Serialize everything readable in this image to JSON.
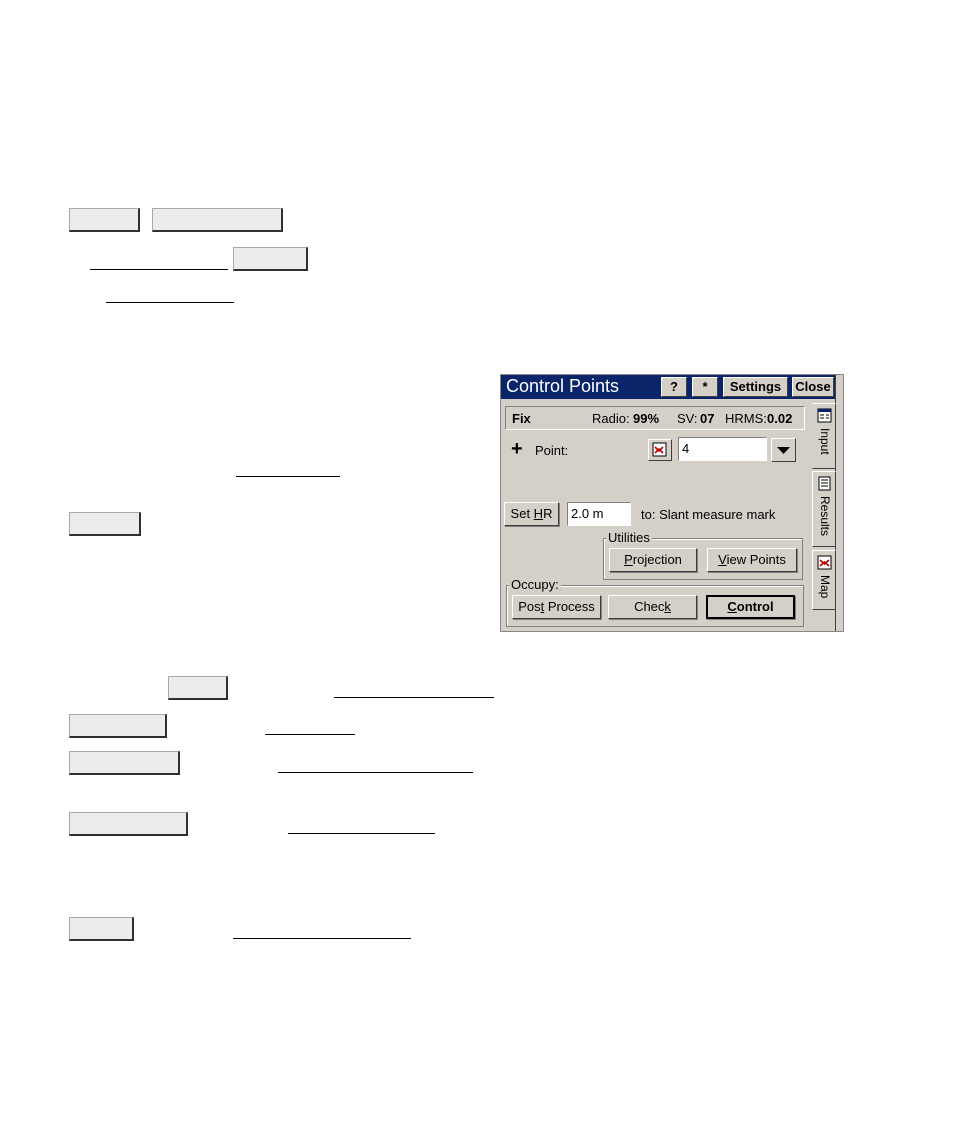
{
  "window": {
    "title": "Control Points",
    "help_label": "?",
    "star_label": "*",
    "settings_label": "Settings",
    "close_label": "Close"
  },
  "status": {
    "fix": "Fix",
    "radio_label": "Radio:",
    "radio_value": "99%",
    "sv_label": "SV:",
    "sv_value": "07",
    "hrms_label": "HRMS:",
    "hrms_value": "0.02"
  },
  "point": {
    "plus": "+",
    "label": "Point:",
    "value": "4"
  },
  "height": {
    "set_hr_prefix": "Set ",
    "set_hr_mnemonic": "H",
    "set_hr_suffix": "R",
    "value": "2.0 m",
    "to_label": "to: Slant measure mark"
  },
  "utilities": {
    "label": "Utilities",
    "projection_mnemonic": "P",
    "projection_rest": "rojection",
    "view_points_mnemonic": "V",
    "view_points_rest": "iew Points"
  },
  "occupy": {
    "label": "Occupy:",
    "post_process_a": "Pos",
    "post_process_mnemonic": "t",
    "post_process_b": " Process",
    "check_a": "Chec",
    "check_mnemonic": "k",
    "control_mnemonic": "C",
    "control_rest": "ontrol"
  },
  "tabs": {
    "input": "Input",
    "results": "Results",
    "map": "Map"
  },
  "colors": {
    "titlebar": "#0a246a",
    "face": "#d4d0c8",
    "icon_red": "#c00000"
  }
}
